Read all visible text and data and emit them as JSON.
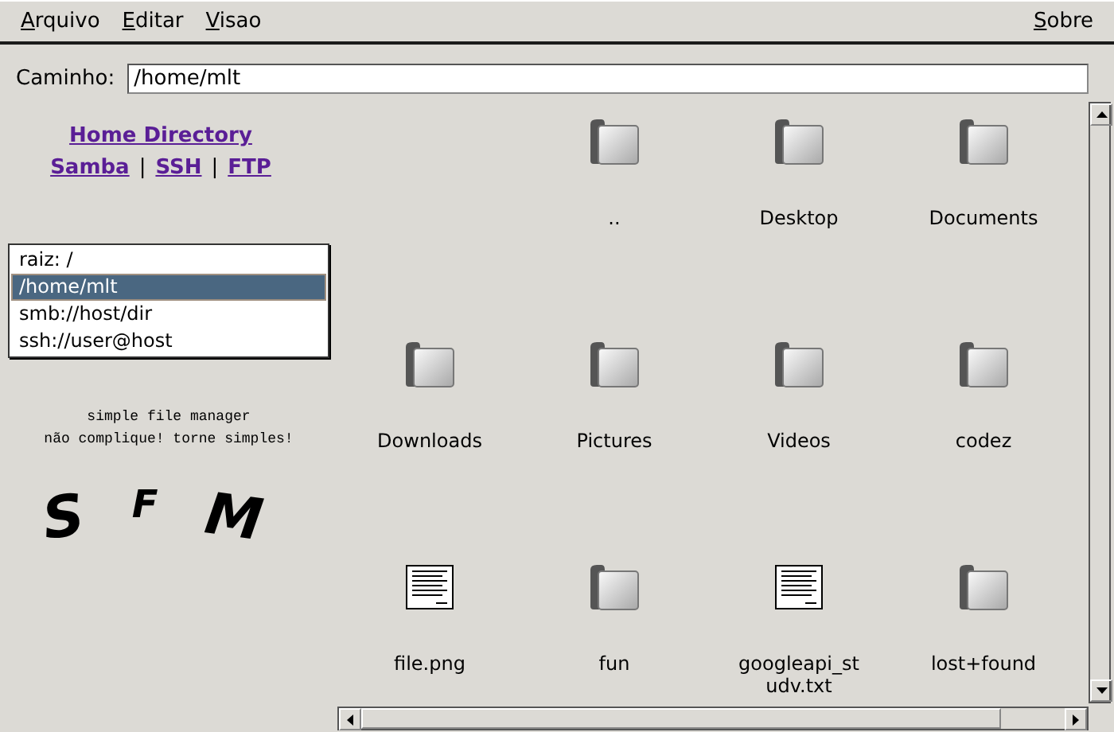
{
  "menu": [
    {
      "accel": "A",
      "rest": "rquivo"
    },
    {
      "accel": "E",
      "rest": "ditar"
    },
    {
      "accel": "V",
      "rest": "isao"
    }
  ],
  "help_menu": {
    "accel": "S",
    "rest": "obre"
  },
  "path": {
    "label": "Caminho:",
    "value": "/home/mlt"
  },
  "links": {
    "home": "Home Directory",
    "protocols": [
      "Samba",
      "SSH",
      "FTP"
    ],
    "separator": "|"
  },
  "locations": [
    {
      "label": "raiz: /",
      "selected": false
    },
    {
      "label": "/home/mlt",
      "selected": true
    },
    {
      "label": "smb://host/dir",
      "selected": false
    },
    {
      "label": "ssh://user@host",
      "selected": false
    }
  ],
  "tagline": [
    "simple file manager",
    "não complique! torne simples!"
  ],
  "logo": [
    "S",
    "F",
    "M"
  ],
  "files": [
    {
      "name": "..",
      "kind": "folder"
    },
    {
      "name": "Desktop",
      "kind": "folder"
    },
    {
      "name": "Documents",
      "kind": "folder"
    },
    {
      "name": "Downloads",
      "kind": "folder"
    },
    {
      "name": "Pictures",
      "kind": "folder"
    },
    {
      "name": "Videos",
      "kind": "folder"
    },
    {
      "name": "codez",
      "kind": "folder"
    },
    {
      "name": "file.png",
      "kind": "file"
    },
    {
      "name": "fun",
      "kind": "folder"
    },
    {
      "name": "googleapi_studv.txt",
      "kind": "file"
    },
    {
      "name": "lost+found",
      "kind": "folder"
    }
  ]
}
